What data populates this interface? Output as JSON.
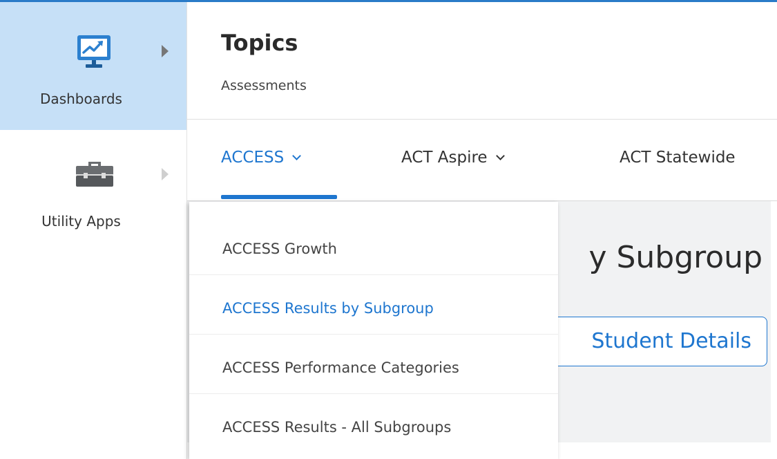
{
  "colors": {
    "accent": "#1e76cf",
    "sidebar_active_bg": "#c6e0f7",
    "content_bg": "#f1f2f3"
  },
  "sidebar": {
    "items": [
      {
        "label": "Dashboards",
        "icon": "dashboard-monitor-icon",
        "active": true
      },
      {
        "label": "Utility Apps",
        "icon": "toolbox-icon",
        "active": false
      }
    ]
  },
  "header": {
    "title": "Topics",
    "subtitle": "Assessments"
  },
  "tabs": [
    {
      "label": "ACCESS",
      "active": true,
      "icon": "chevron-down-icon"
    },
    {
      "label": "ACT Aspire",
      "active": false,
      "icon": "chevron-down-icon"
    },
    {
      "label": "ACT Statewide",
      "active": false
    }
  ],
  "content": {
    "title_fragment": "y Subgroup",
    "button_fragment": "Student Details"
  },
  "dropdown": {
    "items": [
      {
        "label": "ACCESS Growth",
        "selected": false
      },
      {
        "label": "ACCESS Results by Subgroup",
        "selected": true
      },
      {
        "label": "ACCESS Performance Categories",
        "selected": false
      },
      {
        "label": "ACCESS Results - All Subgroups",
        "selected": false
      }
    ]
  }
}
